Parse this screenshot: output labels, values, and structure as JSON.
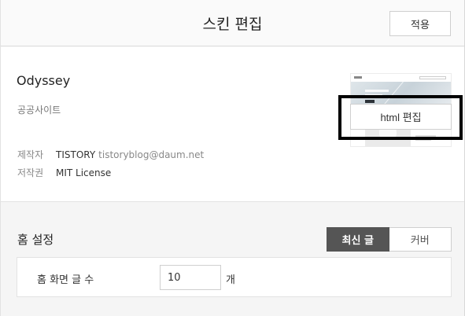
{
  "header": {
    "title": "스킨 편집",
    "apply_label": "적용"
  },
  "skin": {
    "name": "Odyssey",
    "subtitle": "공공사이트",
    "maker_label": "제작자",
    "maker_name": "TISTORY",
    "maker_email": "tistoryblog@daum.net",
    "license_label": "저작권",
    "license_value": "MIT License",
    "preview_icon": "skin-preview-thumbnail"
  },
  "actions": {
    "html_edit_label": "html 편집"
  },
  "home_settings": {
    "title": "홈 설정",
    "tabs": [
      {
        "label": "최신 글",
        "active": true
      },
      {
        "label": "커버",
        "active": false
      }
    ],
    "post_count_label": "홈 화면 글 수",
    "post_count_value": "10",
    "post_count_unit": "개"
  },
  "colors": {
    "active_tab_bg": "#555555",
    "highlight_border": "#000000"
  }
}
